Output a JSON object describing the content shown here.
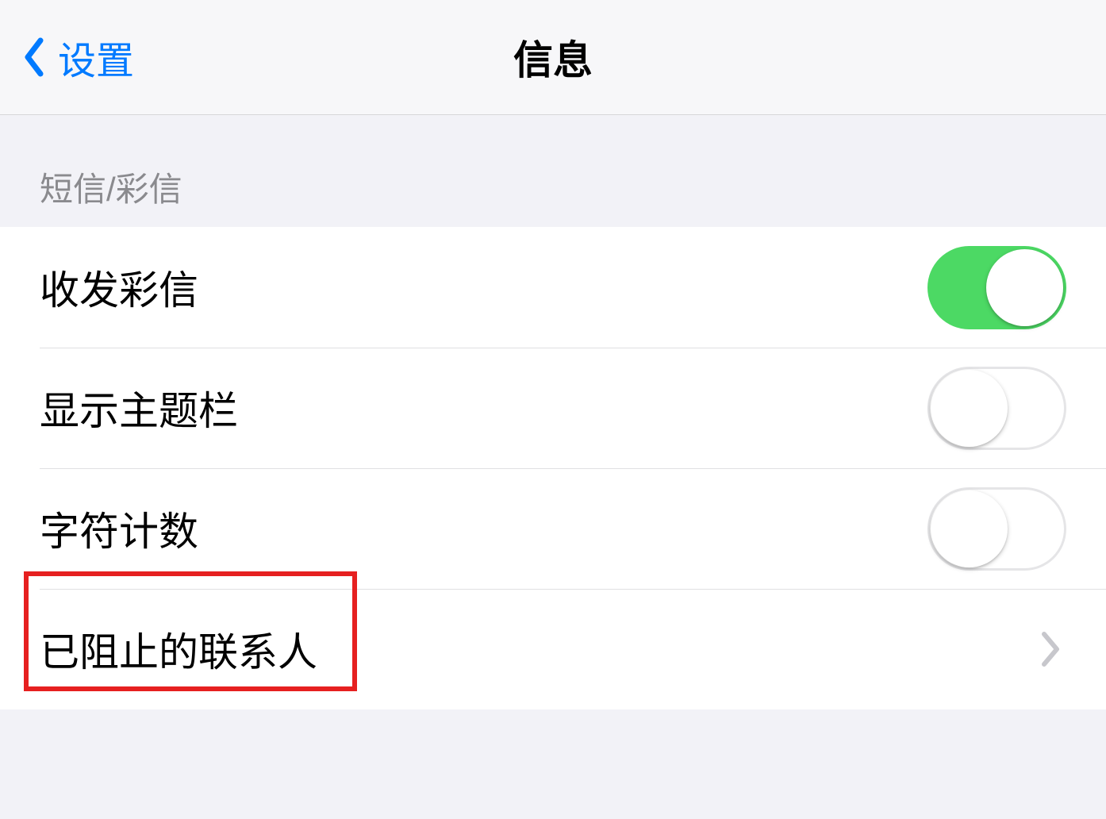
{
  "nav": {
    "back_label": "设置",
    "title": "信息"
  },
  "section": {
    "header": "短信/彩信",
    "rows": {
      "mms": {
        "label": "收发彩信",
        "toggle": true
      },
      "subject": {
        "label": "显示主题栏",
        "toggle": false
      },
      "charcount": {
        "label": "字符计数",
        "toggle": false
      },
      "blocked": {
        "label": "已阻止的联系人"
      }
    }
  }
}
